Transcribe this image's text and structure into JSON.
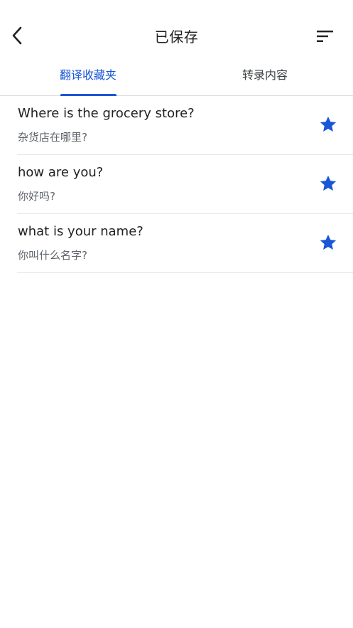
{
  "header": {
    "title": "已保存",
    "back_icon": "chevron-left-icon",
    "sort_icon": "sort-icon"
  },
  "tabs": [
    {
      "label": "翻译收藏夹",
      "active": true
    },
    {
      "label": "转录内容",
      "active": false
    }
  ],
  "colors": {
    "accent": "#1a57d6",
    "text_primary": "#202124",
    "text_secondary": "#5f6368",
    "divider": "#e6e6e6"
  },
  "saved_items": [
    {
      "source": "Where is the grocery store?",
      "translation": "杂货店在哪里?",
      "starred": true
    },
    {
      "source": "how are you?",
      "translation": "你好吗?",
      "starred": true
    },
    {
      "source": "what is your name?",
      "translation": "你叫什么名字?",
      "starred": true
    }
  ]
}
